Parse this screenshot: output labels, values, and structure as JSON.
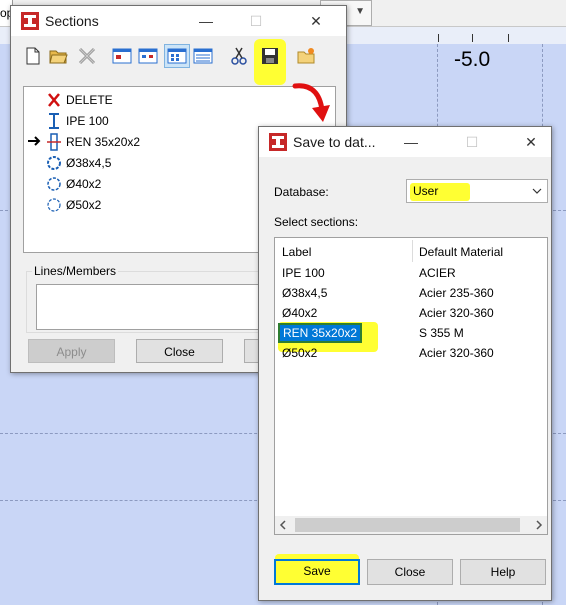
{
  "background": {
    "tab_fragment": "op",
    "ruler_label": "-5.0"
  },
  "sections_window": {
    "title": "Sections",
    "toolbar": [
      "new-icon",
      "open-folder-icon",
      "delete-cross-icon",
      "view-1-icon",
      "view-2-icon",
      "view-3-icon",
      "view-4-icon",
      "scissors-icon",
      "save-database-icon",
      "load-database-icon"
    ],
    "tree": [
      {
        "label": "DELETE",
        "icon": "delete-x-icon",
        "current": false
      },
      {
        "label": "IPE 100",
        "icon": "i-beam-icon",
        "current": false
      },
      {
        "label": "REN 35x20x2",
        "icon": "rect-tube-icon",
        "current": true
      },
      {
        "label": "Ø38x4,5",
        "icon": "tube-icon",
        "current": false
      },
      {
        "label": "Ø40x2",
        "icon": "tube-icon",
        "current": false
      },
      {
        "label": "Ø50x2",
        "icon": "tube-icon",
        "current": false
      }
    ],
    "lines_members_label": "Lines/Members",
    "apply_label": "Apply",
    "close_label": "Close"
  },
  "save_dialog": {
    "title": "Save to dat...",
    "database_label": "Database:",
    "database_value": "User",
    "select_sections_label": "Select sections:",
    "columns": [
      "Label",
      "Default Material"
    ],
    "rows": [
      {
        "label": "IPE 100",
        "material": "ACIER",
        "selected": false
      },
      {
        "label": "Ø38x4,5",
        "material": "Acier 235-360",
        "selected": false
      },
      {
        "label": "Ø40x2",
        "material": "Acier 320-360",
        "selected": false
      },
      {
        "label": "REN 35x20x2",
        "material": "S 355 M",
        "selected": true
      },
      {
        "label": "Ø50x2",
        "material": "Acier 320-360",
        "selected": false
      }
    ],
    "save_label": "Save",
    "close_label": "Close",
    "help_label": "Help"
  },
  "colors": {
    "highlight": "#ffff33",
    "selection": "#0078d7",
    "annotation_arrow": "#e01010"
  }
}
